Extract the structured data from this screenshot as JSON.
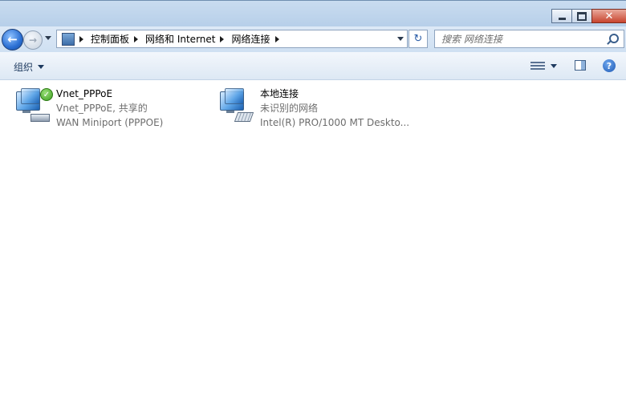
{
  "window": {
    "minimize_icon": "minimize-icon",
    "maximize_icon": "maximize-icon",
    "close_label": "✕"
  },
  "nav": {
    "back_glyph": "←",
    "forward_glyph": "→",
    "breadcrumbs": [
      "控制面板",
      "网络和 Internet",
      "网络连接"
    ],
    "refresh_glyph": "↻",
    "search_placeholder": "搜索 网络连接"
  },
  "toolbar": {
    "organize_label": "组织",
    "help_glyph": "?"
  },
  "connections": [
    {
      "name": "Vnet_PPPoE",
      "status": "Vnet_PPPoE, 共享的",
      "device": "WAN Miniport (PPPOE)",
      "badge_glyph": "✓"
    },
    {
      "name": "本地连接",
      "status": "未识别的网络",
      "device": "Intel(R) PRO/1000 MT Deskto..."
    }
  ]
}
